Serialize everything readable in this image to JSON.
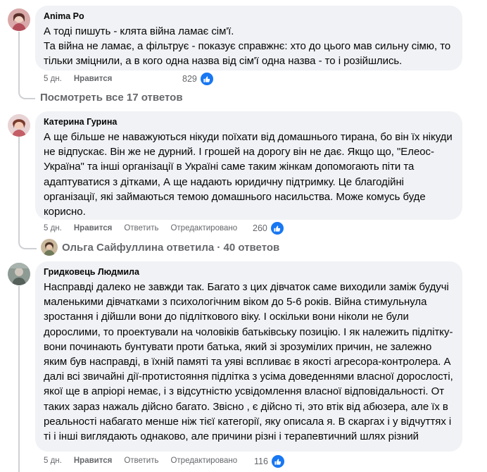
{
  "comments": [
    {
      "author": "Anima Po",
      "text": "А тоді пишуть - клята війна ламає сім'ї.\nТа війна не ламає, а фільтрує - показує справжнє: хто до цього мав сильну сімю, то тільки зміцнили, а в кого одна назва від сім'ї одна назва - то і розійшлись.",
      "time": "5 дн.",
      "like_label": "Нравится",
      "reaction_count": "829",
      "view_replies": "Посмотреть все 17 ответов"
    },
    {
      "author": "Катерина Гурина",
      "text": "А ще більше не наважуються нікуди поїхати від домашнього тирана, бо він їх нікуди не відпускає. Він же не дурний. І грошей на дорогу він не дає. Якщо що, \"Елеос- Україна\" та інші організації в Україні саме таким жінкам допомогають піти та адаптуватися з дітками, А ще надають юридичну підтримку. Це благодійні організації, які займаються темою домашнього насильства. Може комусь буде корисно.",
      "time": "5 дн.",
      "like_label": "Нравится",
      "reply_label": "Ответить",
      "edited_label": "Отредактировано",
      "reaction_count": "260",
      "replied_by": "Ольга Сайфуллина ответила · 40 ответов"
    },
    {
      "author": "Гридковець Людмила",
      "text": "Насправді далеко не завжди так. Багато з цих дівчаток саме виходили заміж будучі маленькими дівчатками з психологічним віком до 5-6 років. Війна стимульнула зростання і дійшли вони до підліткового віку. І оскільки вони ніколи не були дорослими, то проектували на чоловіків батьківську позицію. І як належить підлітку- вони починають бунтувати проти батька, який зі зрозумілих причин, не залежно яким був насправді, в їхній памяті та уяві вспливає в якості агресора-контролера. А далі всі звичайні дії-протистояння підлітка з усіма доведеннями власної дорослості, якої ще в апріорі немає, і з відсутністю усвідомлення власної відповідальності. От таких зараз нажаль дійсно багато. Звісно , є дійсно ті, это втік від абюзера, але їх в реальності набагато менше ніж тієї категорії, яку описала я. В скаргах і у відчуттях і ті і інші виглядають однаково, але причини різні і терапевтичний шлях різний",
      "time": "5 дн.",
      "like_label": "Нравится",
      "reply_label": "Ответить",
      "edited_label": "Отредактировано",
      "reaction_count": "116"
    }
  ],
  "colors": {
    "bubble": "#f0f2f5",
    "meta": "#65676b",
    "like_blue": "#1877f2"
  },
  "icons": [
    "like-icon"
  ]
}
